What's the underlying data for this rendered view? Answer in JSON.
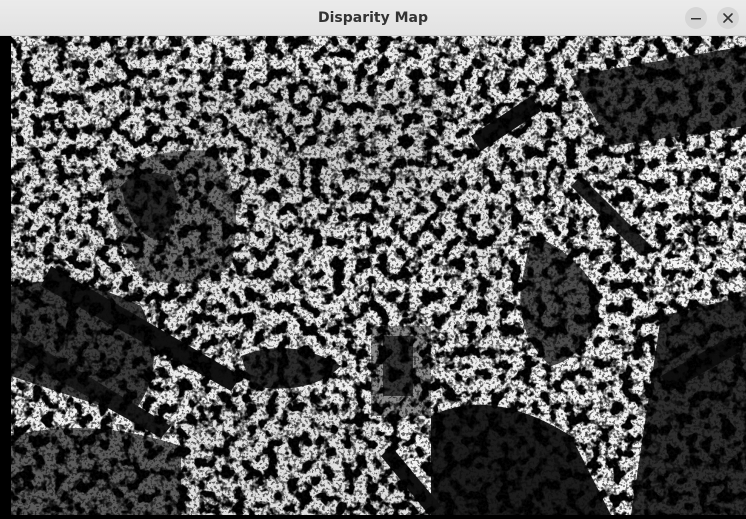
{
  "window": {
    "title": "Disparity Map",
    "minimize_icon": "minimize-icon",
    "close_icon": "close-icon"
  },
  "image": {
    "description_icon": "disparity-map-image",
    "colormap": "grayscale"
  }
}
